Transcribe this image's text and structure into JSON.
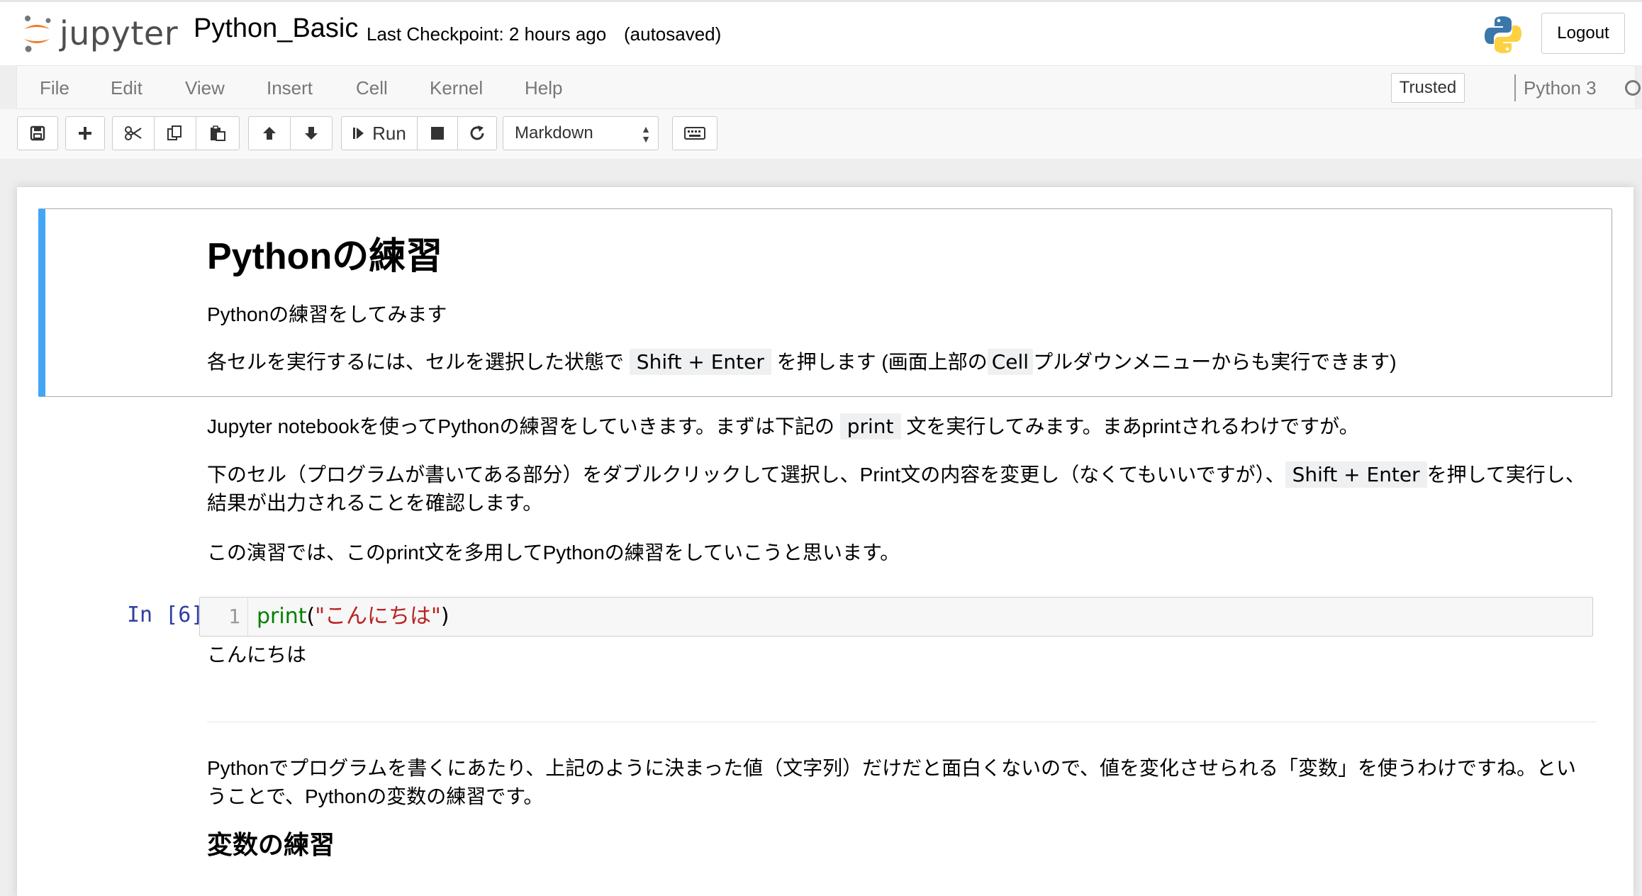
{
  "header": {
    "logo_text": "jupyter",
    "notebook_name": "Python_Basic",
    "checkpoint": "Last Checkpoint: 2 hours ago",
    "autosave": "(autosaved)",
    "logout_label": "Logout"
  },
  "menubar": {
    "items": [
      "File",
      "Edit",
      "View",
      "Insert",
      "Cell",
      "Kernel",
      "Help"
    ],
    "trusted_label": "Trusted",
    "kernel_name": "Python 3"
  },
  "toolbar": {
    "run_label": "Run",
    "cell_type": "Markdown"
  },
  "cells": {
    "md1": {
      "heading": "Pythonの練習",
      "p1": "Pythonの練習をしてみます",
      "p2_a": "各セルを実行するには、セルを選択した状態で",
      "p2_kbd": "Shift + Enter",
      "p2_b": "を押します (画面上部の",
      "p2_kbd2": "Cell",
      "p2_c": "プルダウンメニューからも実行できます)"
    },
    "md2": {
      "p1_a": "Jupyter notebookを使ってPythonの練習をしていきます。まずは下記の",
      "p1_kbd": "print",
      "p1_b": "文を実行してみます。まあprintされるわけですが。",
      "p2_a": "下のセル（プログラムが書いてある部分）をダブルクリックして選択し、Print文の内容を変更し（なくてもいいですが）、",
      "p2_kbd": "Shift + Enter",
      "p2_b": "を押して実行し、",
      "p2_line2": "結果が出力されることを確認します。",
      "p3": "この演習では、このprint文を多用してPythonの練習をしていこうと思います。"
    },
    "code1": {
      "prompt": "In [6]:",
      "line_number": "1",
      "code_fn": "print",
      "code_open": "(",
      "code_str": "\"こんにちは\"",
      "code_close": ")",
      "output": "こんにちは"
    },
    "md3": {
      "p1_line1": "Pythonでプログラムを書くにあたり、上記のように決まった値（文字列）だけだと面白くないので、値を変化させられる「変数」を使うわけですね。とい",
      "p1_line2": "うことで、Pythonの変数の練習です。",
      "heading": "変数の練習"
    }
  }
}
